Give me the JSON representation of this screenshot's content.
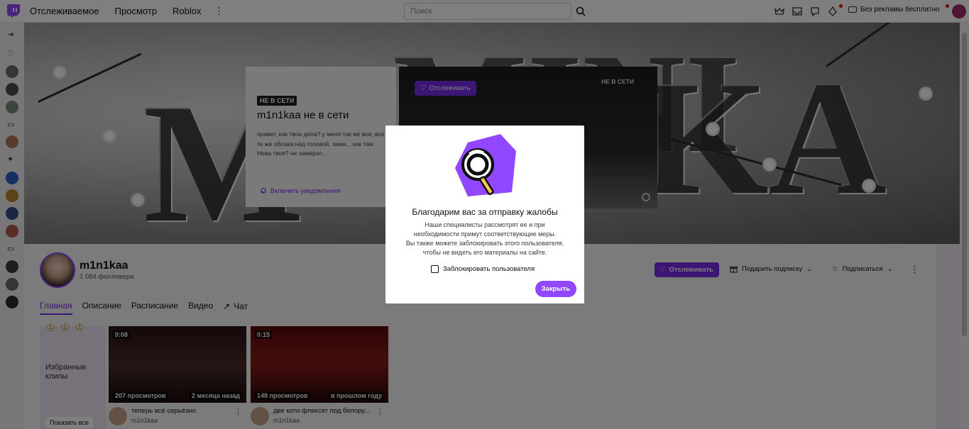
{
  "topnav": {
    "links": [
      "Отслеживаемое",
      "Просмотр",
      "Roblox"
    ],
    "search_placeholder": "Поиск",
    "noads_label": "Без рекламы бесплатно"
  },
  "banner": {
    "letters": "MINIKA"
  },
  "offline_card": {
    "badge": "НЕ В СЕТИ",
    "title_name": "m1n1kaa",
    "title_status": " не в сети",
    "description": "привет, как твои дела? у меня так же все, все те же облака над головой. зима... как там Нева твоя? не замерзл...",
    "notify_label": "Включить уведомления"
  },
  "player": {
    "follow_label": "Отслеживать",
    "badge": "НЕ В СЕТИ"
  },
  "channel": {
    "name": "m1n1kaa",
    "followers": "1 084 фолловера",
    "follow_label": "Отслеживать",
    "gift_label": "Подарить подписку",
    "subscribe_label": "Подписаться",
    "tabs": [
      "Главная",
      "Описание",
      "Расписание",
      "Видео",
      "Чат"
    ]
  },
  "featured": {
    "title": "Избранные клипы",
    "show_all": "Показать все"
  },
  "clips": [
    {
      "duration": "0:08",
      "views": "207 просмотров",
      "when": "2 месяца назад",
      "title": "теперь всё серьёзно",
      "channel": "m1n1kaa"
    },
    {
      "duration": "0:15",
      "views": "148 просмотров",
      "when": "в прошлом году",
      "title": "две коти флексят под белору...",
      "channel": "m1n1kaa"
    }
  ],
  "modal": {
    "title": "Благодарим вас за отправку жалобы",
    "body_lines": [
      "Наши специалисты рассмотрят ее и при",
      "необходимости примут соответствующие меры.",
      "Вы также можете заблокировать этого пользователя,",
      "чтобы не видеть его материалы на сайте."
    ],
    "checkbox_label": "Заблокировать пользователя",
    "close_label": "Закрыть"
  },
  "colors": {
    "brand_purple": "#9147ff",
    "follow_purple": "#772ce8",
    "live_red": "#eb0400"
  }
}
